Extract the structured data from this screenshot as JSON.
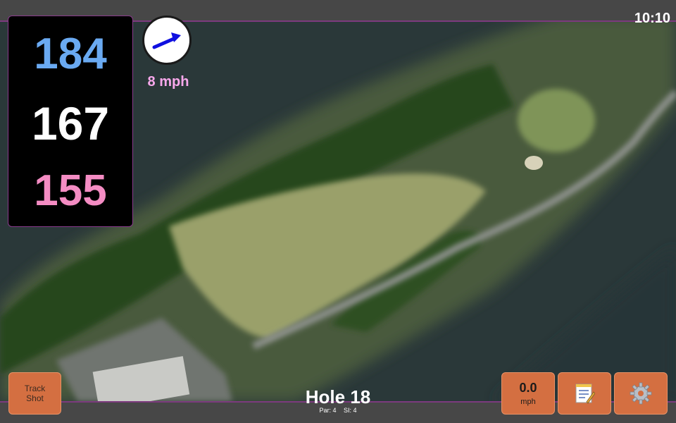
{
  "status": {
    "clock": "10:10"
  },
  "yardages": {
    "back": "184",
    "middle": "167",
    "front": "155"
  },
  "wind": {
    "speed_label": "8 mph",
    "direction_icon": "arrow-icon"
  },
  "hole": {
    "title": "Hole 18",
    "par_label": "Par: 4",
    "si_label": "SI: 4"
  },
  "buttons": {
    "track_label": "Track Shot",
    "speed_value": "0.0",
    "speed_unit": "mph",
    "notes_icon": "notepad-icon",
    "settings_icon": "gear-icon"
  },
  "colors": {
    "back_yardage": "#6aaaf2",
    "middle_yardage": "#ffffff",
    "front_yardage": "#f48cc3",
    "button": "#d46f41",
    "accent_border": "#8a3a8d"
  }
}
